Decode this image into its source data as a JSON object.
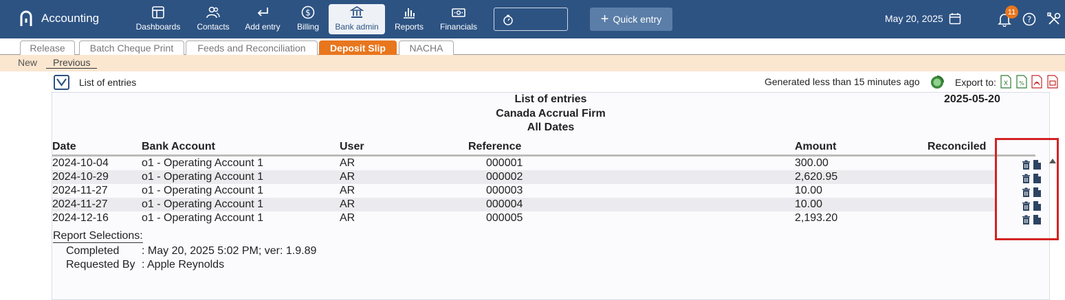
{
  "app": {
    "name": "Accounting"
  },
  "nav": [
    {
      "label": "Dashboards",
      "icon": "dashboard-icon"
    },
    {
      "label": "Contacts",
      "icon": "contacts-icon"
    },
    {
      "label": "Add entry",
      "icon": "add-entry-icon"
    },
    {
      "label": "Billing",
      "icon": "billing-icon"
    },
    {
      "label": "Bank admin",
      "icon": "bank-icon",
      "active": true
    },
    {
      "label": "Reports",
      "icon": "reports-icon"
    },
    {
      "label": "Financials",
      "icon": "financials-icon"
    }
  ],
  "quick_entry": "Quick entry",
  "header_date": "May 20, 2025",
  "notifications_count": "11",
  "tabs": [
    {
      "label": "Release"
    },
    {
      "label": "Batch Cheque Print"
    },
    {
      "label": "Feeds and Reconciliation"
    },
    {
      "label": "Deposit Slip",
      "active": true
    },
    {
      "label": "NACHA"
    }
  ],
  "subnav": {
    "new": "New",
    "previous": "Previous"
  },
  "report_bar": {
    "title": "List of entries",
    "generated": "Generated less than 15 minutes ago",
    "export_label": "Export to:"
  },
  "report": {
    "title": "List of entries",
    "firm": "Canada Accrual Firm",
    "period": "All Dates",
    "date": "2025-05-20",
    "columns": {
      "date": "Date",
      "bank_account": "Bank Account",
      "user": "User",
      "reference": "Reference",
      "amount": "Amount",
      "reconciled": "Reconciled"
    },
    "rows": [
      {
        "date": "2024-10-04",
        "bank_account": "o1 - Operating Account 1",
        "user": "AR",
        "reference": "000001",
        "amount": "300.00"
      },
      {
        "date": "2024-10-29",
        "bank_account": "o1 - Operating Account 1",
        "user": "AR",
        "reference": "000002",
        "amount": "2,620.95"
      },
      {
        "date": "2024-11-27",
        "bank_account": "o1 - Operating Account 1",
        "user": "AR",
        "reference": "000003",
        "amount": "10.00"
      },
      {
        "date": "2024-11-27",
        "bank_account": "o1 - Operating Account 1",
        "user": "AR",
        "reference": "000004",
        "amount": "10.00"
      },
      {
        "date": "2024-12-16",
        "bank_account": "o1 - Operating Account 1",
        "user": "AR",
        "reference": "000005",
        "amount": "2,193.20"
      }
    ],
    "selections": {
      "title": "Report Selections:",
      "completed_label": "Completed",
      "completed_value": ":  May 20, 2025 5:02 PM; ver: 1.9.89",
      "requested_label": "Requested By",
      "requested_value": ":  Apple Reynolds"
    }
  },
  "colors": {
    "brand": "#2d5383",
    "accent": "#e8761d",
    "highlight": "#d32222"
  }
}
